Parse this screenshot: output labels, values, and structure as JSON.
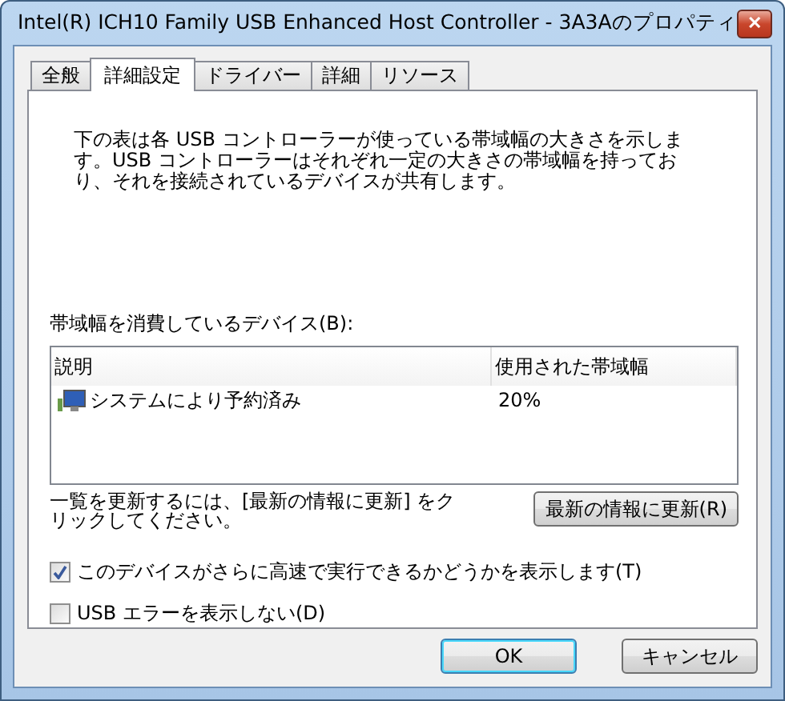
{
  "window": {
    "title": "Intel(R) ICH10 Family USB Enhanced Host Controller - 3A3Aのプロパティ",
    "close": "✕"
  },
  "tabs": [
    {
      "label": "全般",
      "selected": false
    },
    {
      "label": "詳細設定",
      "selected": true
    },
    {
      "label": "ドライバー",
      "selected": false
    },
    {
      "label": "詳細",
      "selected": false
    },
    {
      "label": "リソース",
      "selected": false
    }
  ],
  "description": "下の表は各 USB コントローラーが使っている帯域幅の大きさを示します。USB コントローラーはそれぞれ一定の大きさの帯域幅を持っており、それを接続されているデバイスが共有します。",
  "devices_label": "帯域幅を消費しているデバイス(B):",
  "table": {
    "columns": [
      "説明",
      "使用された帯域幅"
    ],
    "rows": [
      {
        "cells": [
          "システムにより予約済み",
          "20%"
        ]
      }
    ]
  },
  "refresh_hint": "一覧を更新するには、[最新の情報に更新] をクリックしてください。",
  "refresh_button": "最新の情報に更新(R)",
  "options": [
    {
      "label": "このデバイスがさらに高速で実行できるかどうかを表示します(T)",
      "checked": true
    },
    {
      "label": "USB エラーを表示しない(D)",
      "checked": false
    }
  ],
  "buttons": [
    {
      "label": "OK",
      "default": true
    },
    {
      "label": "キャンセル",
      "default": false
    }
  ]
}
